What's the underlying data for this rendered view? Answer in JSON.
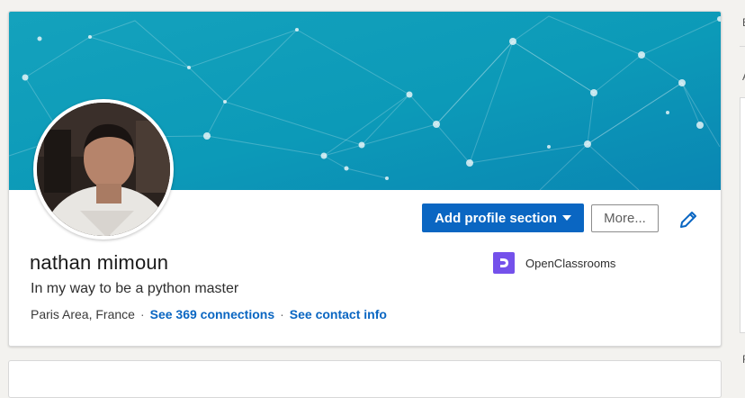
{
  "profile": {
    "name": "nathan mimoun",
    "headline": "In my way to be a python master",
    "location": "Paris Area, France",
    "connections_link": "See 369 connections",
    "contact_link": "See contact info",
    "separator": "·"
  },
  "actions": {
    "add_section_label": "Add profile section",
    "more_label": "More..."
  },
  "company": {
    "name": "OpenClassrooms",
    "logo_color": "#7451eb"
  },
  "sidebar_fragments": {
    "top": "E",
    "middle": "A",
    "bottom": "F"
  },
  "colors": {
    "primary": "#0a66c2",
    "banner_start": "#1aa6bd",
    "banner_end": "#0a86b3"
  },
  "icons": {
    "edit": "pencil-icon",
    "dropdown": "caret-down-icon"
  }
}
